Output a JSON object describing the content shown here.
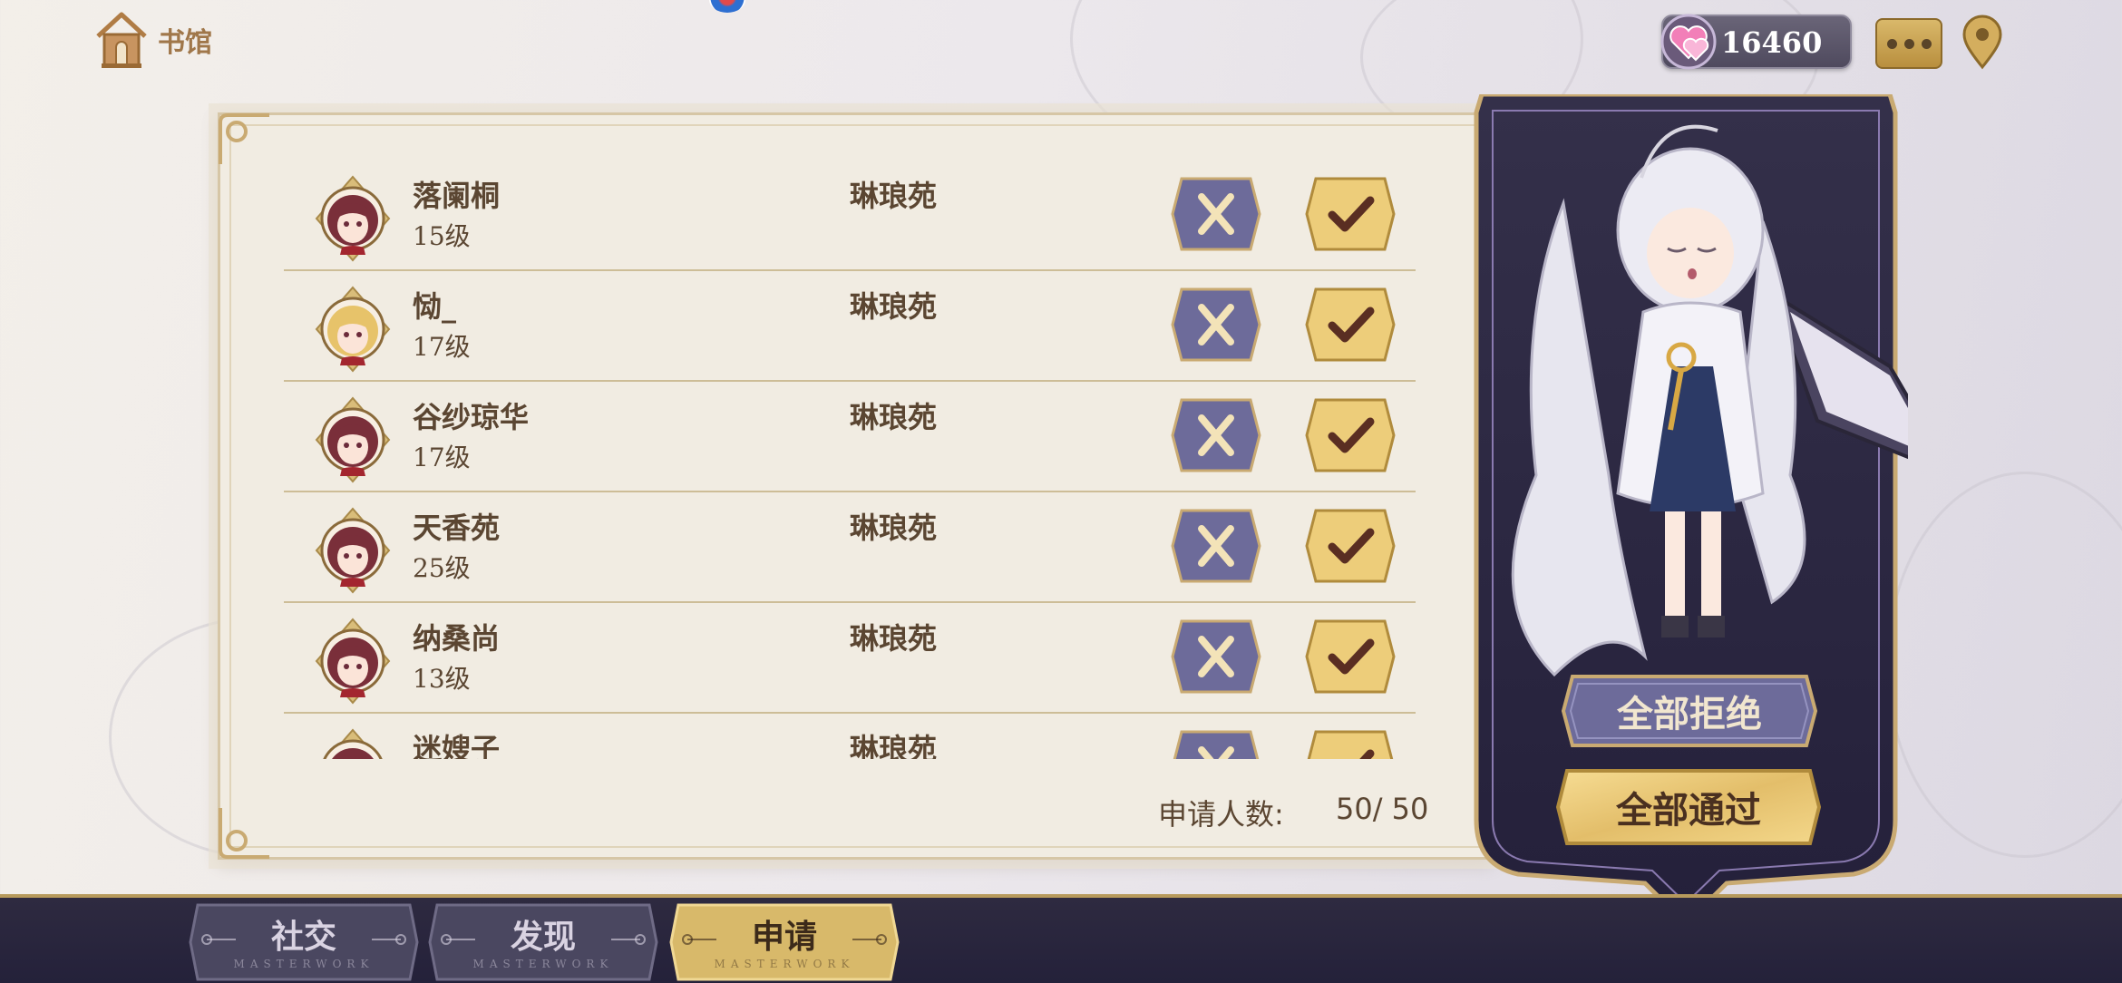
{
  "header": {
    "home_label": "书馆",
    "home_icon": "house-icon",
    "currency_icon": "heart-gem-icon",
    "currency_amount": "16460",
    "chat_icon": "chat-bubble-icon",
    "location_icon": "location-pin-icon"
  },
  "requests": {
    "rows": [
      {
        "name": "落阑桐",
        "level": "15级",
        "guild": "琳琅苑",
        "avatar": "avatar-maroon"
      },
      {
        "name": "恸_",
        "level": "17级",
        "guild": "琳琅苑",
        "avatar": "avatar-blonde"
      },
      {
        "name": "谷纱琼华",
        "level": "17级",
        "guild": "琳琅苑",
        "avatar": "avatar-maroon"
      },
      {
        "name": "天香苑",
        "level": "25级",
        "guild": "琳琅苑",
        "avatar": "avatar-maroon"
      },
      {
        "name": "纳桑尚",
        "level": "13级",
        "guild": "琳琅苑",
        "avatar": "avatar-maroon"
      },
      {
        "name": "迷嫂子",
        "level": "",
        "guild": "琳琅苑",
        "avatar": "avatar-maroon"
      }
    ],
    "count_label": "申请人数:",
    "count_value": "50/ 50",
    "reject_icon": "x-icon",
    "accept_icon": "checkmark-icon"
  },
  "actions": {
    "reject_all": "全部拒绝",
    "accept_all": "全部通过"
  },
  "tabs": [
    {
      "label": "社交",
      "sub": "MASTERWORK",
      "active": false
    },
    {
      "label": "发现",
      "sub": "MASTERWORK",
      "active": false
    },
    {
      "label": "申请",
      "sub": "MASTERWORK",
      "active": true
    }
  ],
  "colors": {
    "accent_gold": "#e8c56e",
    "reject_purple": "#6d6b9a",
    "text_brown": "#5b4632",
    "card_dark": "#2c2840"
  }
}
